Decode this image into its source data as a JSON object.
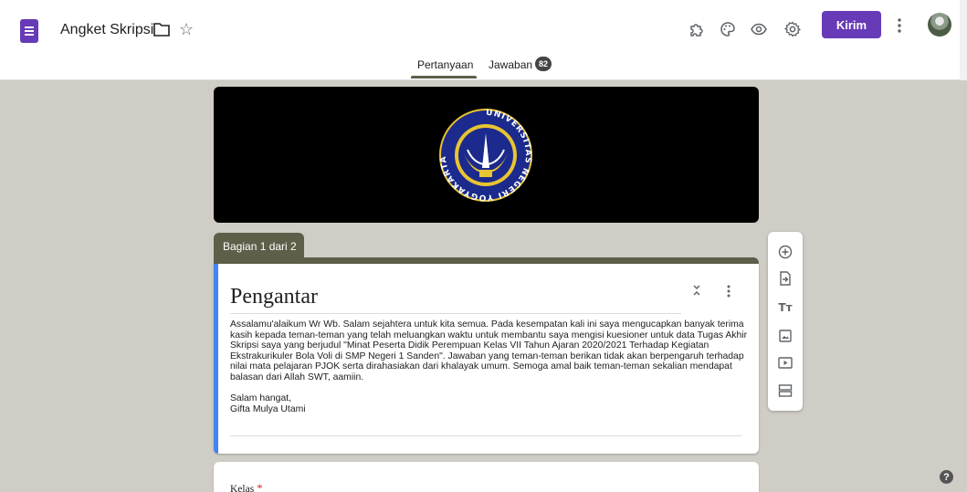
{
  "header": {
    "title": "Angket Skripsi",
    "send_label": "Kirim",
    "icons": [
      "forms-logo-icon",
      "folder-icon",
      "star-icon",
      "addon-icon",
      "palette-icon",
      "preview-eye-icon",
      "settings-gear-icon",
      "more-vert-icon"
    ]
  },
  "tabs": {
    "questions": "Pertanyaan",
    "responses": "Jawaban",
    "responses_count": "82",
    "active": "Pertanyaan"
  },
  "section": {
    "label": "Bagian 1 dari 2",
    "title": "Pengantar",
    "description": "Assalamu'alaikum Wr Wb. Salam sejahtera untuk kita semua. Pada kesempatan kali ini saya mengucapkan banyak terima kasih kepada teman-teman yang telah meluangkan waktu untuk membantu saya mengisi kuesioner untuk data Tugas Akhir Skripsi saya yang berjudul \"Minat Peserta Didik Perempuan Kelas VII Tahun Ajaran 2020/2021 Terhadap Kegiatan Ekstrakurikuler Bola Voli di SMP Negeri 1 Sanden\". Jawaban yang teman-teman berikan tidak akan berpengaruh terhadap nilai mata pelajaran PJOK serta dirahasiakan dari khalayak umum. Semoga amal baik teman-teman sekalian mendapat balasan dari Allah SWT, aamiin.",
    "closing_1": "Salam hangat,",
    "closing_2": "Gifta Mulya Utami"
  },
  "banner": {
    "emblem_text": "UNIVERSITAS NEGERI YOGYAKARTA"
  },
  "question": {
    "label": "Kelas",
    "required_mark": "*"
  },
  "toolbar": {
    "tools": [
      "add-question-icon",
      "import-question-icon",
      "add-title-icon",
      "add-image-icon",
      "add-video-icon",
      "add-section-icon"
    ],
    "title_glyph": "Tт"
  },
  "help": {
    "glyph": "?"
  },
  "colors": {
    "background": "#cfcdc5",
    "accent": "#673ab7",
    "section_theme": "#5e5e49",
    "focus_bar": "#4285f4",
    "required": "#d93025"
  }
}
